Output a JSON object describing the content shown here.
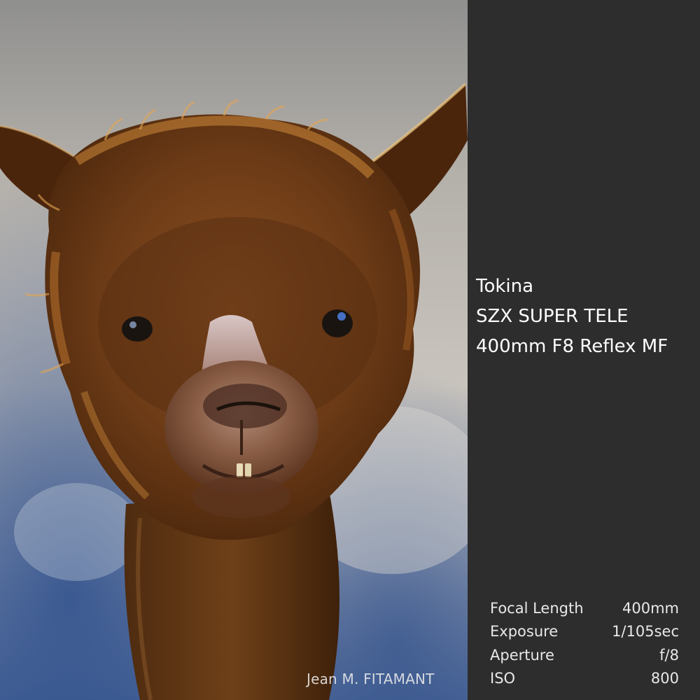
{
  "photo": {
    "subject": "alpaca-portrait",
    "credit": "Jean M. FITAMANT"
  },
  "lens": {
    "brand": "Tokina",
    "model": "SZX SUPER TELE",
    "spec": "400mm F8 Reflex MF"
  },
  "exif": [
    {
      "label": "Focal Length",
      "value": "400mm"
    },
    {
      "label": "Exposure",
      "value": "1/105sec"
    },
    {
      "label": "Aperture",
      "value": "f/8"
    },
    {
      "label": "ISO",
      "value": "800"
    }
  ],
  "colors": {
    "panel": "#2d2d2d",
    "fur": "#6b3a16",
    "fur_highlight": "#c07a32",
    "background_frost": "#b9b4ae",
    "shadow_blue": "#5a6f96"
  }
}
